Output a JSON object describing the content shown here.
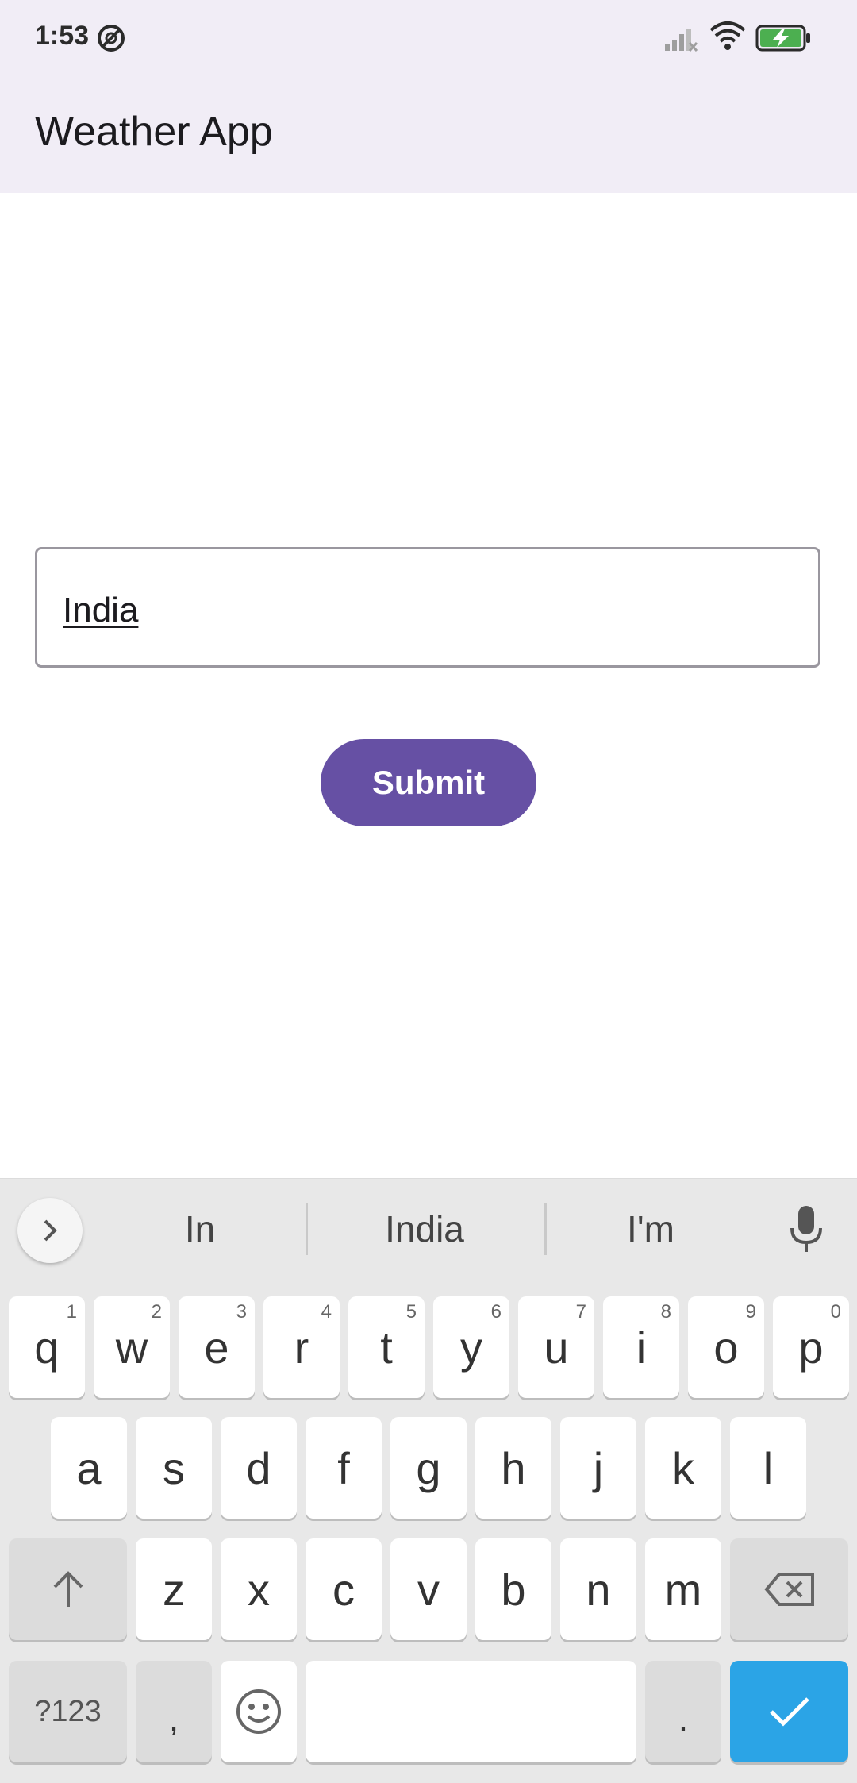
{
  "status_bar": {
    "time": "1:53"
  },
  "app_bar": {
    "title": "Weather App"
  },
  "form": {
    "city_input_value": "India",
    "submit_label": "Submit"
  },
  "keyboard": {
    "suggestions": [
      "In",
      "India",
      "I'm"
    ],
    "row1": [
      {
        "key": "q",
        "hint": "1"
      },
      {
        "key": "w",
        "hint": "2"
      },
      {
        "key": "e",
        "hint": "3"
      },
      {
        "key": "r",
        "hint": "4"
      },
      {
        "key": "t",
        "hint": "5"
      },
      {
        "key": "y",
        "hint": "6"
      },
      {
        "key": "u",
        "hint": "7"
      },
      {
        "key": "i",
        "hint": "8"
      },
      {
        "key": "o",
        "hint": "9"
      },
      {
        "key": "p",
        "hint": "0"
      }
    ],
    "row2": [
      "a",
      "s",
      "d",
      "f",
      "g",
      "h",
      "j",
      "k",
      "l"
    ],
    "row3": [
      "z",
      "x",
      "c",
      "v",
      "b",
      "n",
      "m"
    ],
    "symbols_label": "?123",
    "comma_label": ",",
    "period_label": "."
  },
  "colors": {
    "app_bar_bg": "#f1edf6",
    "primary": "#6650a4",
    "keyboard_bg": "#e8e8e8",
    "enter_key": "#2ba4e6"
  },
  "icons": {
    "status": [
      "dnd-icon",
      "signal-icon",
      "wifi-icon",
      "battery-charging-icon"
    ],
    "keyboard": [
      "chevron-right-icon",
      "mic-icon",
      "shift-icon",
      "backspace-icon",
      "emoji-icon",
      "check-icon"
    ]
  }
}
